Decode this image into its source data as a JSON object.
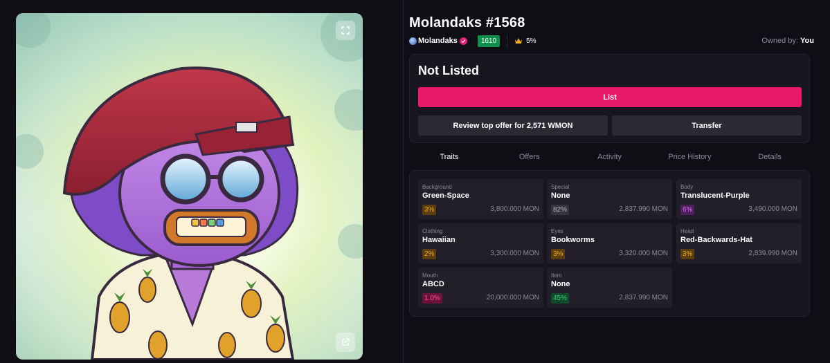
{
  "nft": {
    "title": "Molandaks #1568",
    "collection": "Molandaks",
    "rank": "1610",
    "royalty": "5%",
    "owned_by_label": "Owned by:",
    "owner": "You"
  },
  "listing": {
    "status": "Not Listed",
    "list_label": "List",
    "offer_label": "Review top offer for 2,571 WMON",
    "transfer_label": "Transfer"
  },
  "tabs": [
    {
      "label": "Traits",
      "active": true
    },
    {
      "label": "Offers",
      "active": false
    },
    {
      "label": "Activity",
      "active": false
    },
    {
      "label": "Price History",
      "active": false
    },
    {
      "label": "Details",
      "active": false
    }
  ],
  "traits": [
    {
      "type": "Background",
      "value": "Green-Space",
      "pct": "3%",
      "price": "3,800.000 MON",
      "color": "#f0a81a",
      "bg": "#5a3e0f"
    },
    {
      "type": "Special",
      "value": "None",
      "pct": "82%",
      "price": "2,837.990 MON",
      "color": "#b6b3c4",
      "bg": "#36333f"
    },
    {
      "type": "Body",
      "value": "Translucent-Purple",
      "pct": "6%",
      "price": "3,490.000 MON",
      "color": "#e070ff",
      "bg": "#4a1f5a"
    },
    {
      "type": "Clothing",
      "value": "Hawaiian",
      "pct": "2%",
      "price": "3,300.000 MON",
      "color": "#f0a81a",
      "bg": "#5a3e0f"
    },
    {
      "type": "Eyes",
      "value": "Bookworms",
      "pct": "3%",
      "price": "3,320.000 MON",
      "color": "#f0a81a",
      "bg": "#5a3e0f"
    },
    {
      "type": "Head",
      "value": "Red-Backwards-Hat",
      "pct": "3%",
      "price": "2,839.990 MON",
      "color": "#f0a81a",
      "bg": "#5a3e0f"
    },
    {
      "type": "Mouth",
      "value": "ABCD",
      "pct": "1.0%",
      "price": "20,000.000 MON",
      "color": "#ff4d8f",
      "bg": "#6a1238"
    },
    {
      "type": "Item",
      "value": "None",
      "pct": "45%",
      "price": "2,837.990 MON",
      "color": "#39d27a",
      "bg": "#0f4a2a"
    }
  ],
  "icons": {
    "fullscreen": "fullscreen-icon",
    "external": "external-link-icon",
    "verified": "verified-check-icon",
    "crown": "crown-icon"
  },
  "colors": {
    "accent": "#e8186a",
    "rank_badge": "#0e8f4c",
    "background": "#0f0e15"
  }
}
